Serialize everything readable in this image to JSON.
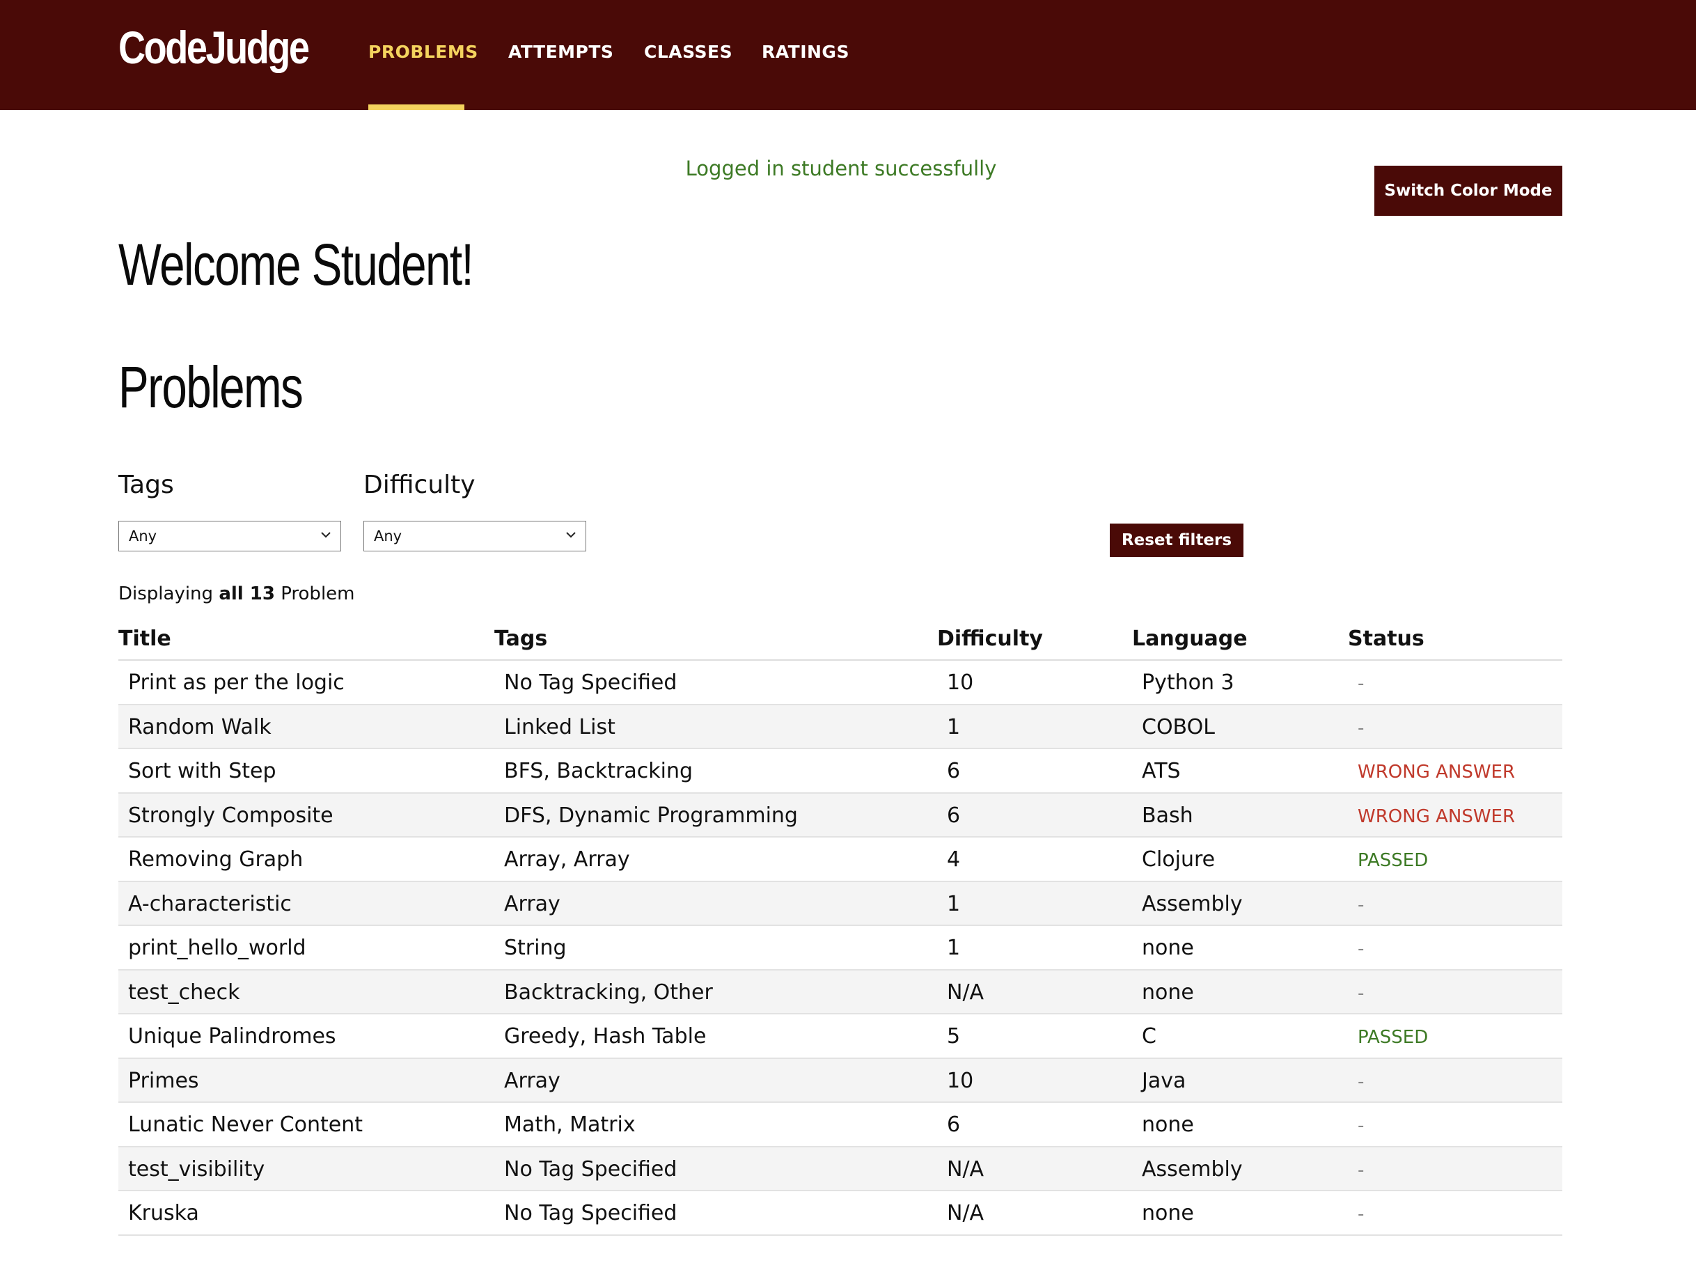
{
  "app": {
    "brand": "CodeJudge",
    "nav": [
      {
        "label": "PROBLEMS",
        "active": true
      },
      {
        "label": "ATTEMPTS",
        "active": false
      },
      {
        "label": "CLASSES",
        "active": false
      },
      {
        "label": "RATINGS",
        "active": false
      }
    ],
    "accent_color": "#f4d35e",
    "brand_color": "#4a0a07"
  },
  "flash_message": "Logged in student successfully",
  "switch_color_mode_label": "Switch Color Mode",
  "welcome_heading": "Welcome Student!",
  "problems_heading": "Problems",
  "filters": {
    "tags_label": "Tags",
    "tags_value": "Any",
    "difficulty_label": "Difficulty",
    "difficulty_value": "Any",
    "reset_label": "Reset filters"
  },
  "count_line": {
    "prefix": "Displaying",
    "bold": "all 13",
    "suffix": "Problem"
  },
  "table": {
    "headers": [
      "Title",
      "Tags",
      "Difficulty",
      "Language",
      "Status"
    ],
    "rows": [
      {
        "title": "Print as per the logic",
        "tags": "No Tag Specified",
        "difficulty": "10",
        "language": "Python 3",
        "status": "-",
        "status_type": "none"
      },
      {
        "title": "Random Walk",
        "tags": "Linked List",
        "difficulty": "1",
        "language": "COBOL",
        "status": "-",
        "status_type": "none"
      },
      {
        "title": "Sort with Step",
        "tags": "BFS, Backtracking",
        "difficulty": "6",
        "language": "ATS",
        "status": "WRONG ANSWER",
        "status_type": "wrong"
      },
      {
        "title": "Strongly Composite",
        "tags": "DFS, Dynamic Programming",
        "difficulty": "6",
        "language": "Bash",
        "status": "WRONG ANSWER",
        "status_type": "wrong"
      },
      {
        "title": "Removing Graph",
        "tags": "Array, Array",
        "difficulty": "4",
        "language": "Clojure",
        "status": "PASSED",
        "status_type": "pass"
      },
      {
        "title": "A-characteristic",
        "tags": "Array",
        "difficulty": "1",
        "language": "Assembly",
        "status": "-",
        "status_type": "none"
      },
      {
        "title": "print_hello_world",
        "tags": "String",
        "difficulty": "1",
        "language": "none",
        "status": "-",
        "status_type": "none"
      },
      {
        "title": "test_check",
        "tags": "Backtracking, Other",
        "difficulty": "N/A",
        "language": "none",
        "status": "-",
        "status_type": "none"
      },
      {
        "title": "Unique Palindromes",
        "tags": "Greedy, Hash Table",
        "difficulty": "5",
        "language": "C",
        "status": "PASSED",
        "status_type": "pass"
      },
      {
        "title": "Primes",
        "tags": "Array",
        "difficulty": "10",
        "language": "Java",
        "status": "-",
        "status_type": "none"
      },
      {
        "title": "Lunatic Never Content",
        "tags": "Math, Matrix",
        "difficulty": "6",
        "language": "none",
        "status": "-",
        "status_type": "none"
      },
      {
        "title": "test_visibility",
        "tags": "No Tag Specified",
        "difficulty": "N/A",
        "language": "Assembly",
        "status": "-",
        "status_type": "none"
      },
      {
        "title": "Kruska",
        "tags": "No Tag Specified",
        "difficulty": "N/A",
        "language": "none",
        "status": "-",
        "status_type": "none"
      }
    ]
  }
}
